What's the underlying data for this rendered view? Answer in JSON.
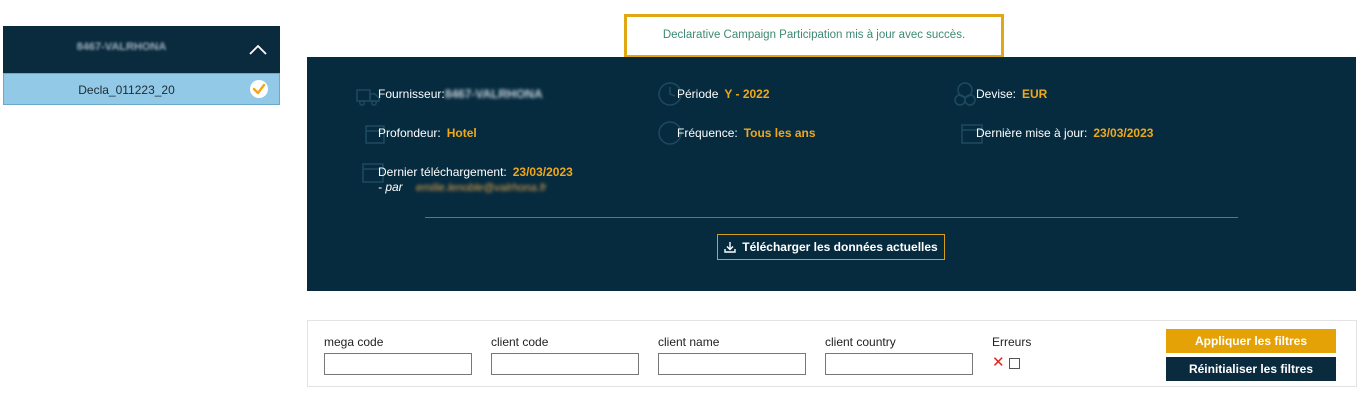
{
  "sidebar": {
    "header_title": "8467-VALRHONA",
    "selected_item": "Decla_011223_20",
    "icons": {
      "collapse": "chevron-up-icon",
      "selected": "check-circle-icon"
    }
  },
  "toast": {
    "message": "Declarative Campaign Participation mis à jour avec succès."
  },
  "info": {
    "fournisseur_label": "Fournisseur:",
    "fournisseur_value": "8467-VALRHONA",
    "periode_label": "Période",
    "periode_value": "Y - 2022",
    "devise_label": "Devise:",
    "devise_value": "EUR",
    "profondeur_label": "Profondeur:",
    "profondeur_value": "Hotel",
    "frequence_label": "Fréquence:",
    "frequence_value": "Tous les ans",
    "maj_label": "Dernière mise à jour:",
    "maj_value": "23/03/2023",
    "telechargement_label": "Dernier téléchargement:",
    "telechargement_value": "23/03/2023",
    "par_label": "- par",
    "par_value": "emilie.lenoble@valrhona.fr",
    "download_button": "Télécharger les données actuelles",
    "icons": [
      "truck-icon",
      "clock-icon",
      "currency-icon",
      "building-icon",
      "refresh-icon",
      "calendar-icon",
      "calendar-icon",
      "download-icon"
    ]
  },
  "filters": {
    "mega_code_label": "mega code",
    "client_code_label": "client code",
    "client_name_label": "client name",
    "client_country_label": "client country",
    "errors_label": "Erreurs",
    "mega_code_value": "",
    "client_code_value": "",
    "client_name_value": "",
    "client_country_value": "",
    "errors_checked": false,
    "apply_button": "Appliquer les filtres",
    "reset_button": "Réinitialiser les filtres"
  },
  "colors": {
    "navy": "#062b3f",
    "accent": "#e5a206",
    "selected": "#92c9e6",
    "success_text": "#3d8a74"
  }
}
